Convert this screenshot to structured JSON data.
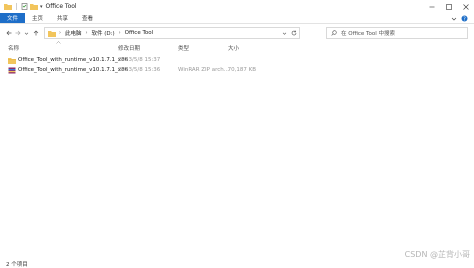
{
  "window": {
    "title": "Office Tool",
    "quick_access_label": "▾"
  },
  "ribbon": {
    "tabs": [
      "文件",
      "主页",
      "共享",
      "查看"
    ]
  },
  "address": {
    "crumbs": [
      "此电脑",
      "软件 (D:)",
      "Office Tool"
    ]
  },
  "search": {
    "placeholder": "在 Office Tool 中搜索"
  },
  "columns": {
    "name": "名称",
    "modified": "修改日期",
    "type": "类型",
    "size": "大小"
  },
  "files": [
    {
      "icon": "folder-icon",
      "name": "Office_Tool_with_runtime_v10.1.7.1_x86",
      "modified": "2023/5/8 15:37",
      "type": "",
      "size": ""
    },
    {
      "icon": "winrar-archive-icon",
      "name": "Office_Tool_with_runtime_v10.1.7.1_x86",
      "modified": "2023/5/8 15:36",
      "type": "WinRAR ZIP arch...",
      "size": "70,187 KB"
    }
  ],
  "status": {
    "count": "2 个项目"
  },
  "watermark": "CSDN @芷背小哥",
  "colors": {
    "accent": "#1e6ec8",
    "folder": "#f2c55c"
  }
}
